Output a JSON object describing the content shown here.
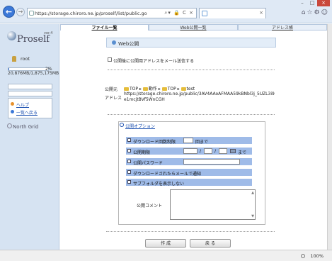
{
  "browser": {
    "url": "https://storage.chiroro.ne.jp/proself/list/public.go",
    "tab_title": "",
    "zoom": "100%"
  },
  "sidebar": {
    "logo_text": "Proself",
    "logo_version": "ver.4",
    "user": "root",
    "quota_percent": 2,
    "quota_percent_label": "2%",
    "quota_text": "20,876MB/1,875,175MB",
    "help_label": "ヘルプ",
    "back_label": "一覧へ戻る",
    "footer_brand": "North Grid"
  },
  "tabs": [
    {
      "label": "ファイル一覧",
      "active": true
    },
    {
      "label": "Web公開一覧",
      "active": false
    },
    {
      "label": "アドレス帳",
      "active": false
    }
  ],
  "main": {
    "title": "Web公開",
    "notify_label": "公開後に公開用アドレスをメール送信する",
    "dest_label": "公開元",
    "path": [
      "TOP",
      "動作",
      "TOP",
      "test"
    ],
    "address_label": "アドレス",
    "public_url": "https://storage.chiroro.ne.jp/public/3AV4AAoAFMAA59kBNbl3j_5UZL3i9e1mcjtBVf5WnCGH"
  },
  "options": {
    "title": "公開オプション",
    "download_limit_label": "ダウンロード回数制限",
    "download_limit_unit": "回まで",
    "period_label": "公開期限",
    "period_sep": "/",
    "period_until": "まで",
    "password_label": "公開パスワード",
    "mail_notify_label": "ダウンロードされたらメールで通知",
    "hide_sub_label": "サブフォルダを表示しない",
    "comment_label": "公開コメント"
  },
  "buttons": {
    "create": "作 成",
    "back": "戻 る"
  }
}
